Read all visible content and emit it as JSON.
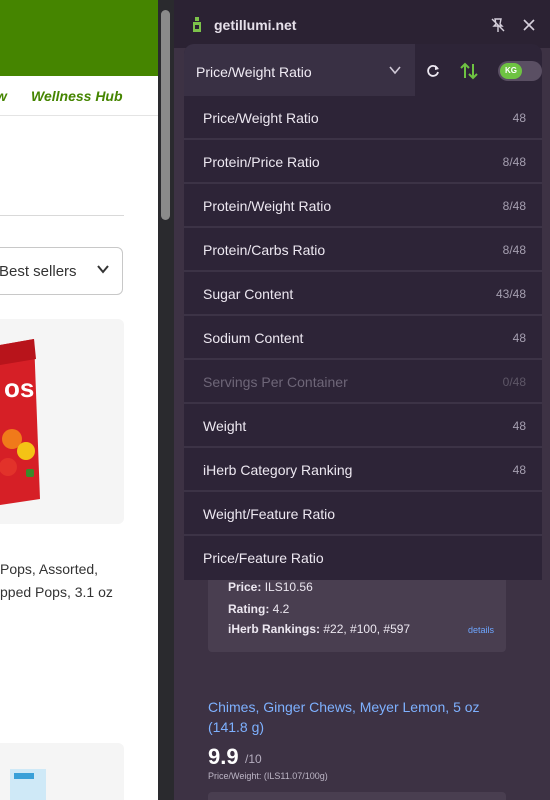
{
  "site": {
    "nav_prev": "w",
    "nav_hub": "Wellness Hub",
    "sort_label": "Best sellers",
    "product_title_lines": [
      "Pops, Assorted,",
      "pped Pops, 3.1 oz"
    ]
  },
  "extension": {
    "brand": "getillumi.net",
    "selected_sort": "Price/Weight Ratio",
    "unit_toggle": "KG",
    "menu": [
      {
        "label": "Price/Weight Ratio",
        "count": "48",
        "enabled": true
      },
      {
        "label": "Protein/Price Ratio",
        "count": "8/48",
        "enabled": true
      },
      {
        "label": "Protein/Weight Ratio",
        "count": "8/48",
        "enabled": true
      },
      {
        "label": "Protein/Carbs Ratio",
        "count": "8/48",
        "enabled": true
      },
      {
        "label": "Sugar Content",
        "count": "43/48",
        "enabled": true
      },
      {
        "label": "Sodium Content",
        "count": "48",
        "enabled": true
      },
      {
        "label": "Servings Per Container",
        "count": "0/48",
        "enabled": false
      },
      {
        "label": "Weight",
        "count": "48",
        "enabled": true
      },
      {
        "label": "iHerb Category Ranking",
        "count": "48",
        "enabled": true
      },
      {
        "label": "Weight/Feature Ratio",
        "count": "",
        "enabled": true
      },
      {
        "label": "Price/Feature Ratio",
        "count": "",
        "enabled": true
      }
    ],
    "product1": {
      "price_label": "Price:",
      "price": "ILS10.56",
      "rating_label": "Rating:",
      "rating": "4.2",
      "rankings_label": "iHerb Rankings:",
      "rankings": "#22, #100, #597",
      "details_link": "details"
    },
    "product2": {
      "title": "Chimes, Ginger Chews, Meyer Lemon, 5 oz (141.8 g)",
      "score": "9.9",
      "score_out_of": "/10",
      "subtitle": "Price/Weight: (ILS11.07/100g)"
    }
  },
  "colors": {
    "brand_green": "#458500",
    "panel_bg": "#3d3244",
    "menu_bg": "#2d2437",
    "toggle_on": "#6ec342",
    "link_blue": "#7eb1ff"
  },
  "icons": [
    "brand-bottle-icon",
    "unpin-icon",
    "close-icon",
    "chevron-down-icon",
    "refresh-icon",
    "sort-arrows-icon"
  ]
}
